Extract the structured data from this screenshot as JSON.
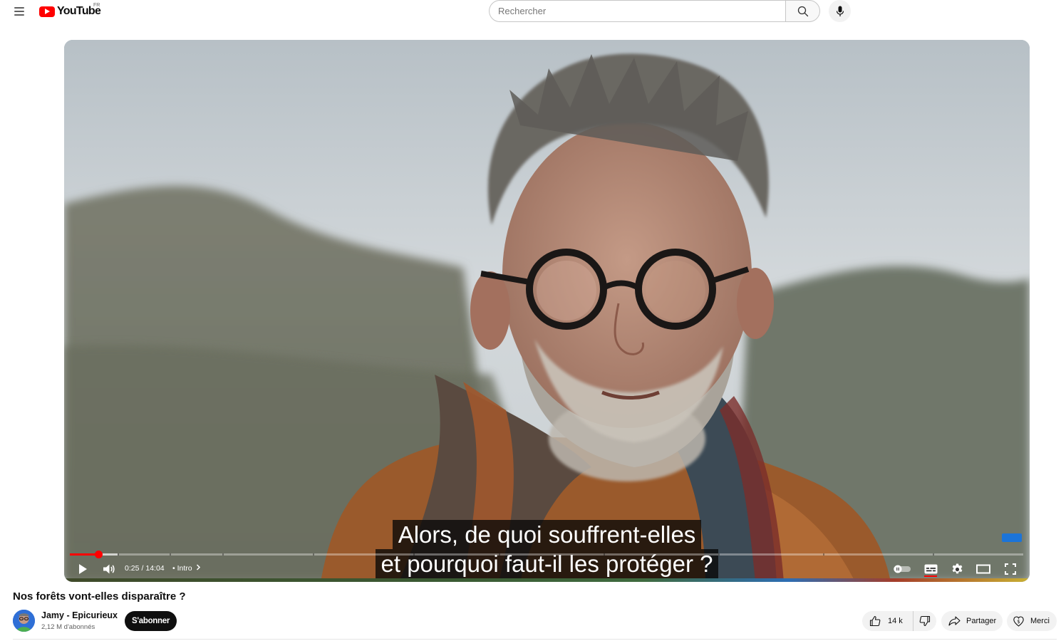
{
  "header": {
    "logo_text": "YouTube",
    "country_code": "FR",
    "search_placeholder": "Rechercher"
  },
  "player": {
    "subtitle_lines": [
      "Alors, de quoi souffrent-elles",
      "et pourquoi faut-il les protéger ?"
    ],
    "current_time": "0:25",
    "duration": "14:04",
    "time_separator": "/",
    "chapter_prefix": "•",
    "chapter": "Intro",
    "progress_played_fraction": 0.03,
    "progress_buffered_fraction": 0.05,
    "chapter_markers_fraction": [
      0.05,
      0.105,
      0.16,
      0.255,
      0.36,
      0.45,
      0.56,
      0.68,
      0.79,
      0.905
    ],
    "accent_color": "#ff0000"
  },
  "video": {
    "title": "Nos forêts vont-elles disparaître ?",
    "channel_name": "Jamy - Epicurieux",
    "subscribers": "2,12 M d'abonnés",
    "subscribe_label": "S'abonner",
    "likes": "14 k",
    "share_label": "Partager",
    "thanks_label": "Merci"
  }
}
